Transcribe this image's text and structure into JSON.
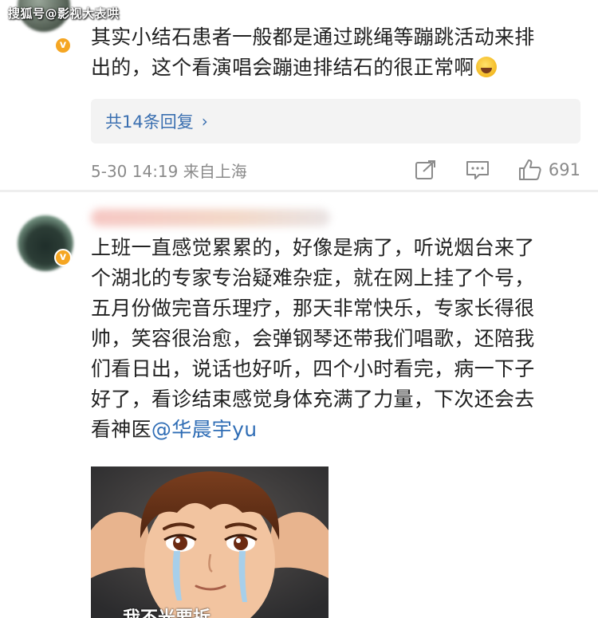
{
  "watermark": "搜狐号@影视大表哄",
  "comment1": {
    "text_line1": "其实小结石患者一般都是通过跳绳等蹦跳活动来排",
    "text_line2": "出的，这个看演唱会蹦迪排结石的很正常啊",
    "emoji_icon": "laughing-tears-emoji",
    "reply_label": "共14条回复",
    "timestamp": "5-30 14:19",
    "location": "来自上海",
    "like_count": "691"
  },
  "comment2": {
    "lines": [
      "上班一直感觉累累的，好像是病了，听说烟台来了",
      "个湖北的专家专治疑难杂症，就在网上挂了个号，",
      "五月份做完音乐理疗，那天非常快乐，专家长得很",
      "帅，笑容很治愈，会弹钢琴还带我们唱歌，还陪我",
      "们看日出，说话也好听，四个小时看完，病一下子",
      "好了，看诊结束感觉身体充满了力量，下次还会去"
    ],
    "last_line_prefix": "看神医",
    "mention": "@华晨宇yu",
    "image_caption_partial": "我不光要拆",
    "image_subject": "crying-cartoon-boy-meme"
  },
  "colors": {
    "mention_blue": "#2f6db5",
    "reply_blue": "#3a6fb0",
    "meta_gray": "#8a8a8a",
    "verified_badge": "#f5a623"
  }
}
